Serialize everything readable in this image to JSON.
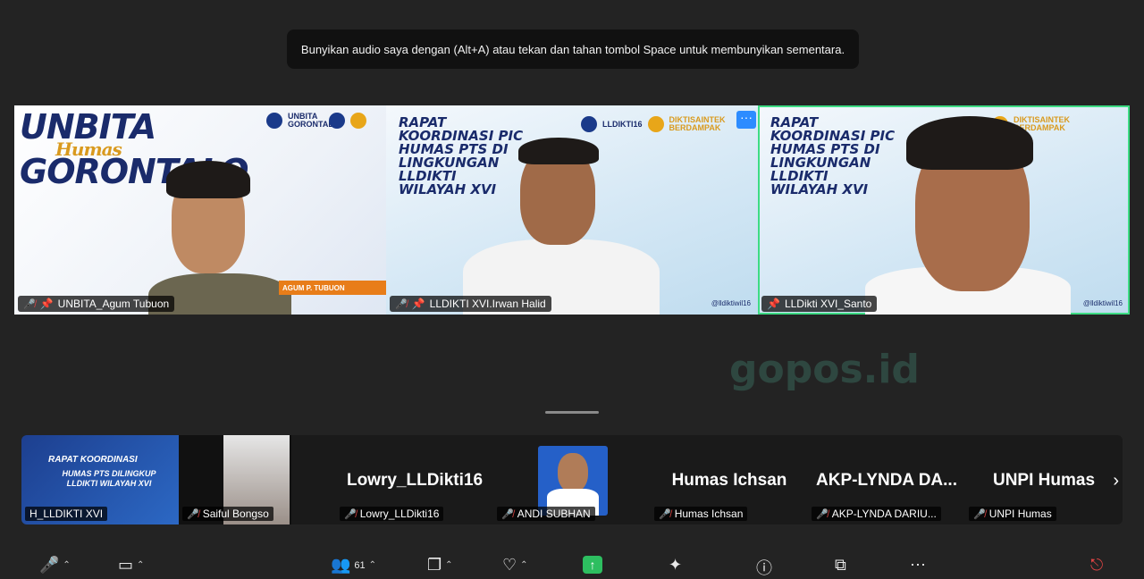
{
  "toast": "Bunyikan audio saya dengan (Alt+A) atau tekan dan tahan tombol Space untuk membunyikan sementara.",
  "tiles": [
    {
      "name": "UNBITA_Agum Tubuon",
      "banner_line1": "UNBITA",
      "banner_script": "Humas",
      "banner_line2": "GORONTALO",
      "logo_text": "UNBITA GORONTALO",
      "person_title": "AGUM P. TUBUON"
    },
    {
      "name": "LLDIKTI XVI.Irwan Halid",
      "banner": "RAPAT KOORDINASI PIC HUMAS PTS DI LINGKUNGAN LLDIKTI WILAYAH XVI",
      "logo_text": "LLDIKTI16",
      "logo_text2": "DIKTISAINTEK BERDAMPAK",
      "social": "@lldiktiwil16"
    },
    {
      "name": "LLDikti XVI_Santo",
      "banner": "RAPAT KOORDINASI PIC HUMAS PTS DI LINGKUNGAN LLDIKTI WILAYAH XVI",
      "logo_text": "DIKTISAINTEK BERDAMPAK",
      "social": "@lldiktiwil16"
    }
  ],
  "watermark": "gopos.id",
  "strip": [
    {
      "name": "H_LLDIKTI XVI",
      "banner": "RAPAT KOORDINASI",
      "banner2": "HUMAS PTS DILINGKUP LLDIKTI WILAYAH XVI"
    },
    {
      "name": "Saiful Bongso"
    },
    {
      "name": "Lowry_LLDikti16",
      "big": "Lowry_LLDikti16"
    },
    {
      "name": "ANDI SUBHAN"
    },
    {
      "name": "Humas Ichsan",
      "big": "Humas Ichsan"
    },
    {
      "name": "AKP-LYNDA DARIU...",
      "big": "AKP-LYNDA  DA..."
    },
    {
      "name": "UNPI Humas",
      "big": "UNPI Humas"
    }
  ],
  "toolbar": {
    "participants_count": "61"
  },
  "colors": {
    "accent_green": "#2dbe60",
    "speaker_border": "#3ddc84",
    "brand_blue": "#1a2b6b",
    "orange": "#e87d19"
  }
}
